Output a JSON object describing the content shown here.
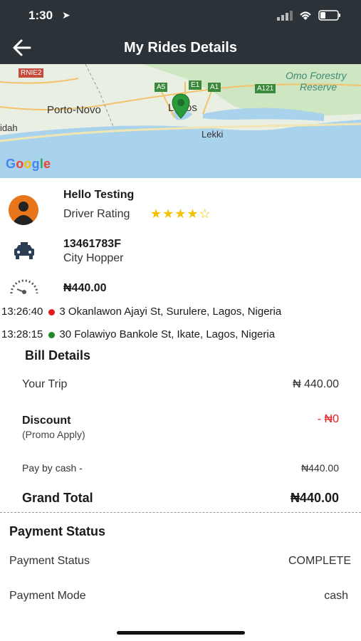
{
  "status": {
    "time": "1:30"
  },
  "nav": {
    "title": "My Rides Details"
  },
  "map": {
    "labels": {
      "rnie2": "RNIE2",
      "porto_novo": "Porto-Novo",
      "idah": "idah",
      "a5": "A5",
      "e1": "E1",
      "a1": "A1",
      "a121": "A121",
      "lagos": "Lagos",
      "lekki": "Lekki",
      "omo": "Omo Forestry",
      "reserve": "Reserve"
    },
    "google": "Google"
  },
  "driver": {
    "name": "Hello Testing",
    "rating_label": "Driver Rating",
    "rating": 4,
    "rating_max": 5
  },
  "vehicle": {
    "plate": "13461783F",
    "type": "City Hopper"
  },
  "fare": {
    "amount": "₦440.00"
  },
  "pickup": {
    "time": "13:26:40",
    "address": "3 Okanlawon Ajayi St, Surulere, Lagos, Nigeria"
  },
  "dropoff": {
    "time": "13:28:15",
    "address": "30 Folawiyo Bankole St, Ikate, Lagos, Nigeria"
  },
  "bill": {
    "heading": "Bill Details",
    "your_trip_label": "Your Trip",
    "your_trip_value": "₦ 440.00",
    "discount_label": "Discount",
    "discount_sub": "(Promo Apply)",
    "discount_value": "- ₦0",
    "pay_label": "Pay by cash -",
    "pay_value": "₦440.00",
    "grand_label": "Grand Total",
    "grand_value": "₦440.00"
  },
  "payment": {
    "heading": "Payment Status",
    "status_label": "Payment Status",
    "status_value": "COMPLETE",
    "mode_label": "Payment Mode",
    "mode_value": "cash"
  },
  "colors": {
    "header": "#2b3338",
    "pickup_dot": "#e31b1b",
    "dropoff_dot": "#1f8a2a",
    "discount": "#e02020",
    "star": "#f2c200",
    "avatar": "#e8751a"
  }
}
